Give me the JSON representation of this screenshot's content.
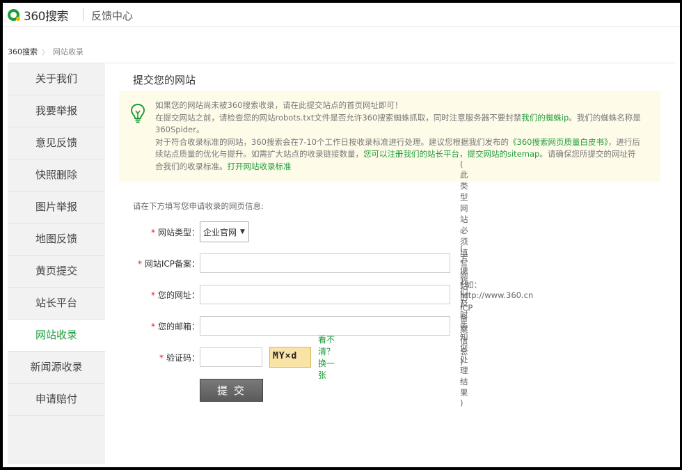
{
  "header": {
    "logo_text": "360搜索",
    "title": "反馈中心"
  },
  "breadcrumb": {
    "home": "360搜索",
    "separator": "〉",
    "current": "网站收录"
  },
  "sidebar": {
    "items": [
      {
        "label": "关于我们"
      },
      {
        "label": "我要举报"
      },
      {
        "label": "意见反馈"
      },
      {
        "label": "快照删除"
      },
      {
        "label": "图片举报"
      },
      {
        "label": "地图反馈"
      },
      {
        "label": "黄页提交"
      },
      {
        "label": "站长平台"
      },
      {
        "label": "网站收录",
        "active": true
      },
      {
        "label": "新闻源收录"
      },
      {
        "label": "申请赔付"
      }
    ]
  },
  "main": {
    "title": "提交您的网站",
    "notice": {
      "icon": "lightbulb-icon",
      "line1": "如果您的网站尚未被360搜索收录，请在此提交站点的首页网址即可！",
      "line2_a": "在提交网站之前，请检查您的网站robots.txt文件是否允许360搜索蜘蛛抓取，同时注意服务器不要封禁",
      "line2_link": "我们的蜘蛛ip",
      "line2_b": "。我们的蜘蛛名称是360Spider。",
      "line3_a": "对于符合收录标准的网站，360搜索会在7-10个工作日按收录标准进行处理。建议您根据我们发布的",
      "line3_link1": "《360搜索网页质量白皮书》",
      "line3_b": "，进行后续站点质量的优化与提升。如需扩大站点的收录链接数量，",
      "line3_link2": "您可以注册我们的站长平台，提交网站的sitemap",
      "line3_c": "。请确保您所提交的网址符合我们的收录标准。",
      "line3_link3": "打开网站收录标准"
    },
    "form": {
      "intro": "请在下方填写您申请收录的网页信息:",
      "required_mark": "*",
      "site_type": {
        "label": "网站类型：",
        "value": "企业官网"
      },
      "icp": {
        "label": "网站ICP备案：",
        "value": "",
        "hint": "( 此类型网站必须填写网站的ICP备案信息 )"
      },
      "url": {
        "label": "您的网址：",
        "value": "",
        "hint": "( 如：http://www.360.cn )"
      },
      "email": {
        "label": "您的邮箱：",
        "value": "",
        "hint": "( 方便我们及时告知您处理结果 )"
      },
      "captcha": {
        "label": "验证码：",
        "value": "",
        "image_text": "MY×d",
        "refresh": "看不清？换一张"
      },
      "submit": "提 交"
    }
  },
  "colors": {
    "accent": "#1c9d3a",
    "notice_bg": "#fffbe9",
    "required": "#e02020"
  }
}
